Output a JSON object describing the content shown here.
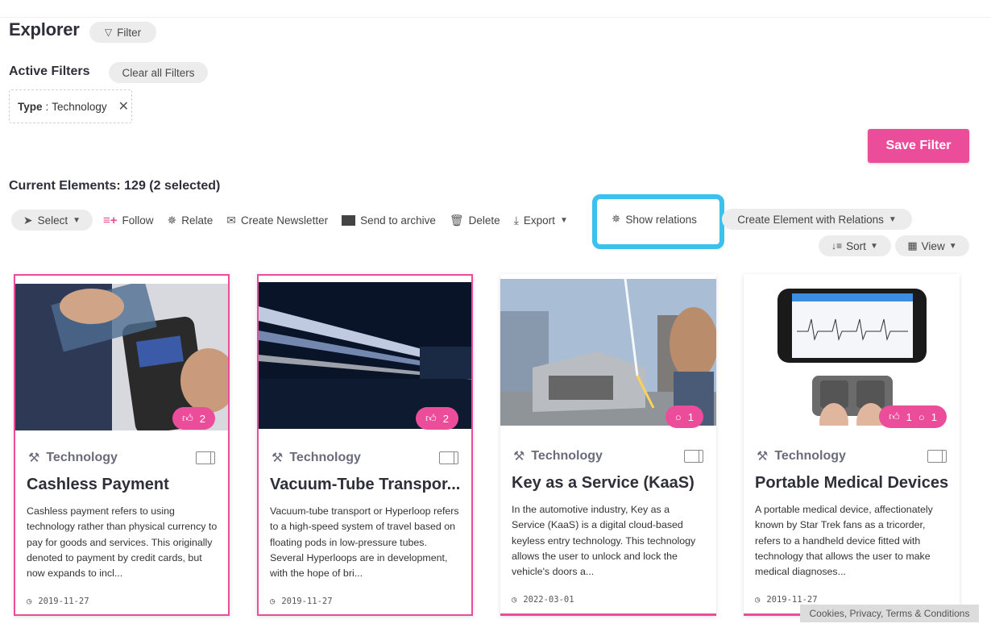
{
  "header": {
    "title": "Explorer",
    "filter_label": "Filter"
  },
  "filters": {
    "heading": "Active Filters",
    "clear_label": "Clear all Filters",
    "chip_key": "Type",
    "chip_value": "Technology"
  },
  "save_filter_label": "Save Filter",
  "current": {
    "label": "Current Elements:",
    "value": "129 (2 selected)"
  },
  "toolbar": {
    "select": "Select",
    "follow": "Follow",
    "relate": "Relate",
    "newsletter": "Create Newsletter",
    "archive": "Send to archive",
    "delete": "Delete",
    "export": "Export",
    "show_relations": "Show relations",
    "create_element": "Create Element with Relations",
    "sort": "Sort",
    "view": "View"
  },
  "colors": {
    "accent": "#ec4d9b",
    "highlight": "#3cc0ee"
  },
  "cards": [
    {
      "type": "Technology",
      "title": "Cashless Payment",
      "desc": "Cashless payment refers to using technology rather than physical currency to pay for goods and services. This originally denoted to payment by credit cards, but now expands to incl...",
      "date": "2019-11-27",
      "likes": "2",
      "comments": "",
      "selected": true
    },
    {
      "type": "Technology",
      "title": "Vacuum-Tube Transpor...",
      "desc": "Vacuum-tube transport or Hyperloop refers to a high-speed system of travel based on floating pods in low-pressure tubes. Several Hyperloops are in development, with the hope of bri...",
      "date": "2019-11-27",
      "likes": "2",
      "comments": "",
      "selected": true
    },
    {
      "type": "Technology",
      "title": "Key as a Service (KaaS)",
      "desc": "In the automotive industry, Key as a Service (KaaS) is a digital cloud-based keyless entry technology. This technology allows the user to unlock and lock the vehicle's doors a...",
      "date": "2022-03-01",
      "likes": "",
      "comments": "1",
      "selected": false
    },
    {
      "type": "Technology",
      "title": "Portable Medical Devices",
      "desc": "A portable medical device, affectionately known by Star Trek fans as a tricorder, refers to a handheld device fitted with technology that allows the user to make medical diagnoses...",
      "date": "2019-11-27",
      "likes": "1",
      "comments": "1",
      "selected": false
    }
  ],
  "footer": {
    "cookies": "Cookies, Privacy, Terms & Conditions"
  }
}
